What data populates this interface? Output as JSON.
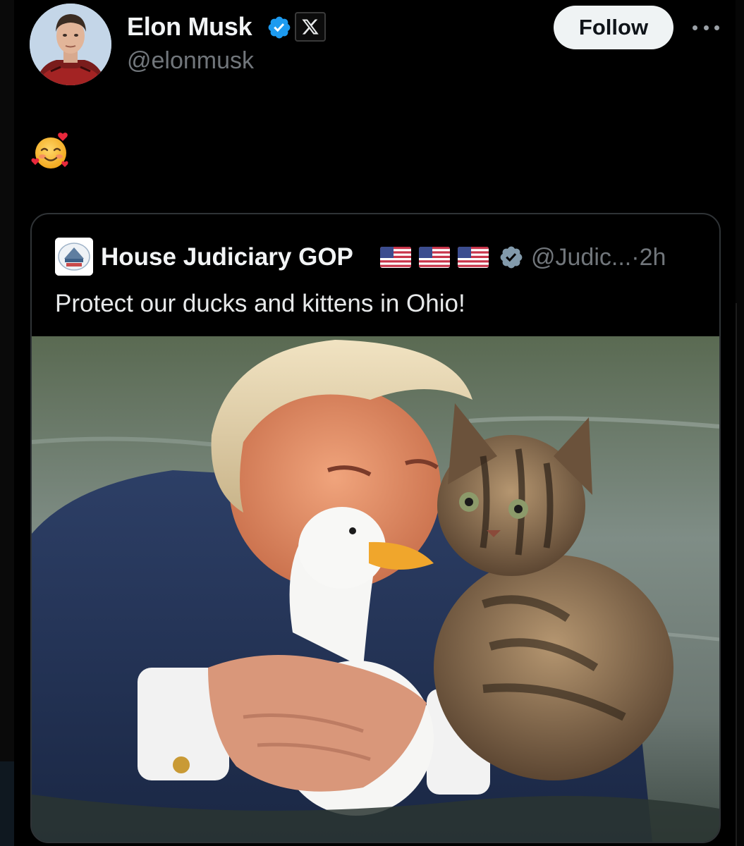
{
  "author": {
    "display_name": "Elon Musk",
    "handle": "@elonmusk",
    "verified": true,
    "affiliation_icon": "x-logo-icon"
  },
  "actions": {
    "follow_label": "Follow",
    "more_icon": "more-horizontal-icon"
  },
  "tweet": {
    "emoji": "🥰",
    "emoji_name": "smiling-face-with-hearts-icon"
  },
  "quoted_tweet": {
    "display_name": "House Judiciary GOP",
    "flags": [
      "us-flag-icon",
      "us-flag-icon",
      "us-flag-icon"
    ],
    "verified": true,
    "handle": "@Judic...",
    "separator": "·",
    "time": "2h",
    "text": "Protect our ducks and kittens in Ohio!",
    "media_description": "photo of a man in a navy suit hugging a white duck and a tabby kitten in water"
  },
  "colors": {
    "background": "#000000",
    "verified_blue": "#1d9bf0",
    "quote_verified": "#829aab",
    "follow_bg": "#eff3f4",
    "secondary_text": "#71767b"
  }
}
